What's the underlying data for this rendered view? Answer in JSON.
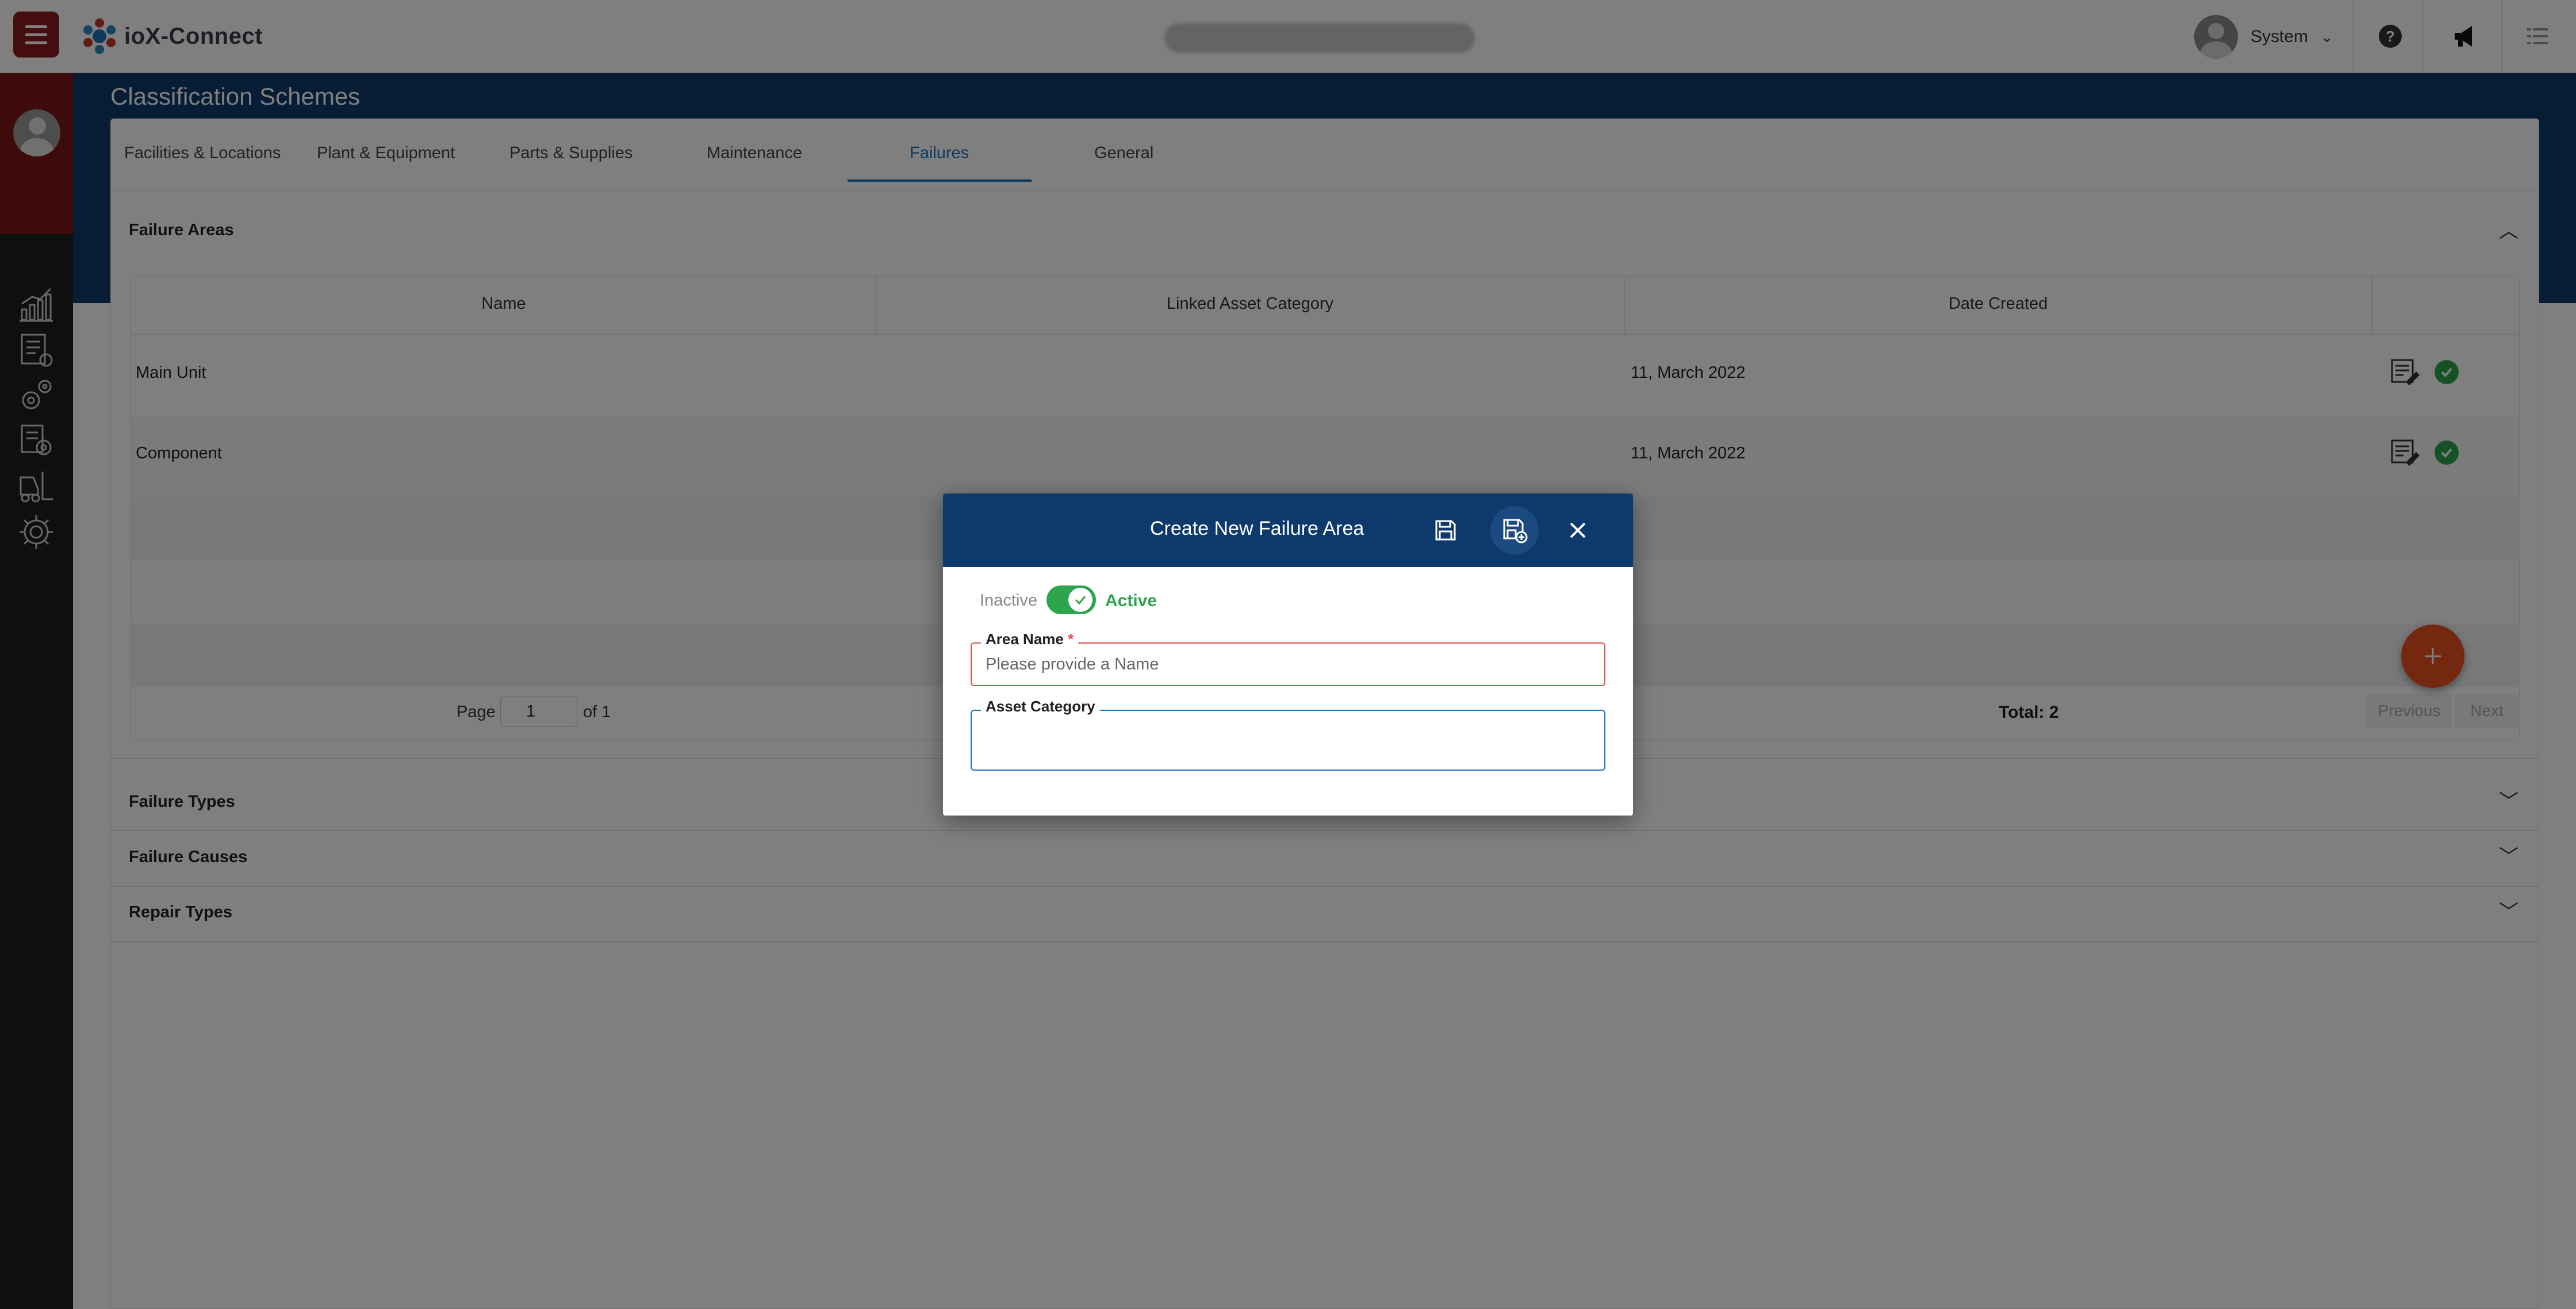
{
  "app": {
    "name": "ioX-Connect",
    "user": "System"
  },
  "page": {
    "title": "Classification Schemes"
  },
  "tabs": [
    {
      "label": "Facilities & Locations"
    },
    {
      "label": "Plant & Equipment"
    },
    {
      "label": "Parts & Supplies"
    },
    {
      "label": "Maintenance"
    },
    {
      "label": "Failures",
      "active": true
    },
    {
      "label": "General"
    }
  ],
  "failure_areas": {
    "title": "Failure Areas",
    "columns": [
      "Name",
      "Linked Asset Category",
      "Date Created"
    ],
    "rows": [
      {
        "name": "Main Unit",
        "linked_category": "",
        "date_created": "11, March 2022"
      },
      {
        "name": "Component",
        "linked_category": "",
        "date_created": "11, March 2022"
      }
    ],
    "pager": {
      "page_label": "Page",
      "page": "1",
      "of_label": "of 1",
      "total": "Total: 2",
      "previous": "Previous",
      "next": "Next"
    }
  },
  "sections": [
    {
      "title": "Failure Types"
    },
    {
      "title": "Failure Causes"
    },
    {
      "title": "Repair Types"
    }
  ],
  "modal": {
    "title": "Create New Failure Area",
    "toggle": {
      "inactive_label": "Inactive",
      "active_label": "Active",
      "on": true
    },
    "area_name": {
      "label": "Area Name",
      "required": "*",
      "placeholder": "Please provide a Name",
      "value": ""
    },
    "asset_category": {
      "label": "Asset Category",
      "value": ""
    }
  },
  "icons": {
    "menu": "hamburger-icon",
    "help": "help-icon",
    "announce": "megaphone-icon",
    "list": "list-icon",
    "save": "save-icon",
    "save_new": "save-and-new-icon",
    "close": "close-icon",
    "edit": "edit-icon",
    "status": "check-circle-icon",
    "add": "plus-icon"
  },
  "colors": {
    "brand_red": "#8b1a1a",
    "header_blue": "#0e3a6b",
    "active_green": "#2ea44f",
    "fab_orange": "#e8501f",
    "tab_blue": "#1e73be",
    "error_red": "#d9534f"
  }
}
